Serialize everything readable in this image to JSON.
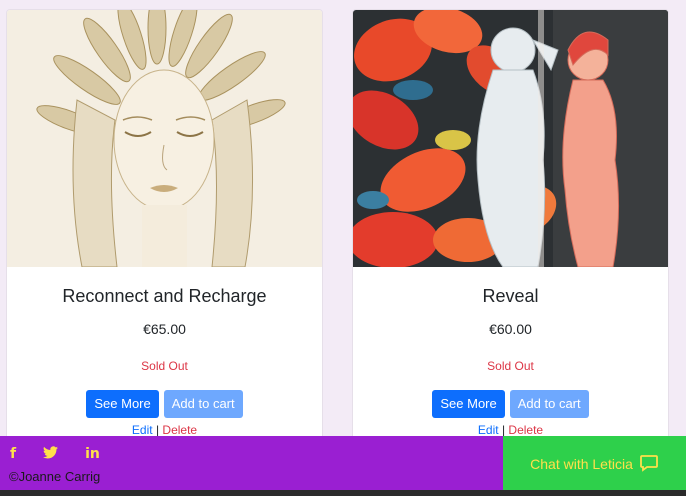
{
  "products": [
    {
      "title": "Reconnect and Recharge",
      "price": "€65.00",
      "status": "Sold Out",
      "see_more": "See More",
      "add_to_cart": "Add to cart",
      "edit": "Edit",
      "separator": "|",
      "delete": "Delete"
    },
    {
      "title": "Reveal",
      "price": "€60.00",
      "status": "Sold Out",
      "see_more": "See More",
      "add_to_cart": "Add to cart",
      "edit": "Edit",
      "separator": "|",
      "delete": "Delete"
    }
  ],
  "footer": {
    "social": [
      {
        "icon": "facebook-icon",
        "glyph": "f"
      },
      {
        "icon": "twitter-icon",
        "glyph": "t"
      },
      {
        "icon": "linkedin-icon",
        "glyph": "in"
      }
    ],
    "copyright": "©Joanne Carrig",
    "chat_label": "Chat with Leticia"
  },
  "colors": {
    "primary": "#0d6efd",
    "sold_out": "#dc3545",
    "footer_bg": "#9a1fd2",
    "chat_bg": "#2ed04b",
    "accent_yellow": "#ffe04a"
  }
}
